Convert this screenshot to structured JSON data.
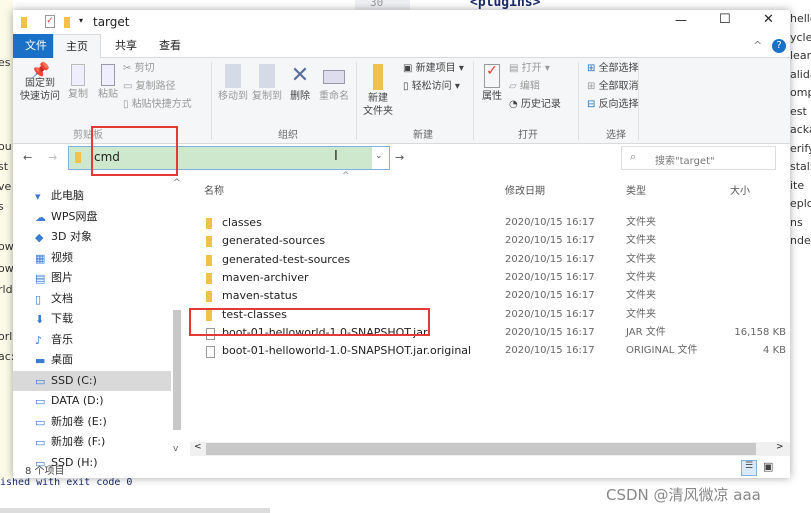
{
  "background": {
    "top_line_no": "30",
    "top_code": "<plugins>",
    "right_snippets": [
      "hellow",
      "ycle",
      "lean",
      "alida",
      "ompi",
      "est",
      "acka",
      "erify",
      "stall",
      "ite",
      "eploy",
      "ns",
      "nder"
    ],
    "left_snippets": [
      "es",
      "ou",
      "st",
      "ve",
      "s",
      "ow",
      "ow",
      "rld",
      "orl",
      "ac:"
    ],
    "console_line": "ished with exit code 0",
    "watermark": "CSDN @清风微凉 aaa"
  },
  "window": {
    "title": "target",
    "controls": {
      "minimize": "—",
      "maximize": "☐",
      "close": "✕"
    },
    "tabs": [
      {
        "label": "文件",
        "active": false,
        "accent": true
      },
      {
        "label": "主页",
        "active": true
      },
      {
        "label": "共享"
      },
      {
        "label": "查看"
      }
    ],
    "help": "?",
    "ribbon": {
      "clipboard": {
        "pin": "固定到\n快速访问",
        "copy": "复制",
        "paste": "粘贴",
        "cut": "剪切",
        "copy_path": "复制路径",
        "paste_shortcut": "粘贴快捷方式",
        "group": "剪贴板"
      },
      "organize": {
        "move_to": "移动到",
        "copy_to": "复制到",
        "delete": "删除",
        "rename": "重命名",
        "group": "组织"
      },
      "new": {
        "new_folder": "新建\n文件夹",
        "new_item": "新建项目",
        "easy_access": "轻松访问",
        "group": "新建"
      },
      "open": {
        "properties": "属性",
        "open": "打开",
        "edit": "编辑",
        "history": "历史记录",
        "group": "打开"
      },
      "select": {
        "select_all": "全部选择",
        "select_none": "全部取消",
        "invert": "反向选择",
        "group": "选择"
      }
    },
    "address": {
      "value": "cmd",
      "search_placeholder": "搜索\"target\""
    },
    "nav_items": [
      "此电脑",
      "WPS网盘",
      "3D 对象",
      "视频",
      "图片",
      "文档",
      "下载",
      "音乐",
      "桌面",
      "SSD (C:)",
      "DATA (D:)",
      "新加卷 (E:)",
      "新加卷 (F:)",
      "SSD (H:)"
    ],
    "nav_selected": "SSD (C:)",
    "columns": {
      "name": "名称",
      "date": "修改日期",
      "type": "类型",
      "size": "大小"
    },
    "files": [
      {
        "name": "classes",
        "date": "2020/10/15 16:17",
        "type": "文件夹",
        "size": "",
        "kind": "folder"
      },
      {
        "name": "generated-sources",
        "date": "2020/10/15 16:17",
        "type": "文件夹",
        "size": "",
        "kind": "folder"
      },
      {
        "name": "generated-test-sources",
        "date": "2020/10/15 16:17",
        "type": "文件夹",
        "size": "",
        "kind": "folder"
      },
      {
        "name": "maven-archiver",
        "date": "2020/10/15 16:17",
        "type": "文件夹",
        "size": "",
        "kind": "folder"
      },
      {
        "name": "maven-status",
        "date": "2020/10/15 16:17",
        "type": "文件夹",
        "size": "",
        "kind": "folder"
      },
      {
        "name": "test-classes",
        "date": "2020/10/15 16:17",
        "type": "文件夹",
        "size": "",
        "kind": "folder"
      },
      {
        "name": "boot-01-helloworld-1.0-SNAPSHOT.jar",
        "date": "2020/10/15 16:17",
        "type": "JAR 文件",
        "size": "16,158 KB",
        "kind": "file"
      },
      {
        "name": "boot-01-helloworld-1.0-SNAPSHOT.jar.original",
        "date": "2020/10/15 16:17",
        "type": "ORIGINAL 文件",
        "size": "4 KB",
        "kind": "file"
      }
    ],
    "status": "8 个项目",
    "colors": {
      "file_tab": "#1a6fc7",
      "address_bg": "#cde8cd",
      "highlight": "#e53935",
      "selected_nav": "#d9d9d9"
    }
  }
}
